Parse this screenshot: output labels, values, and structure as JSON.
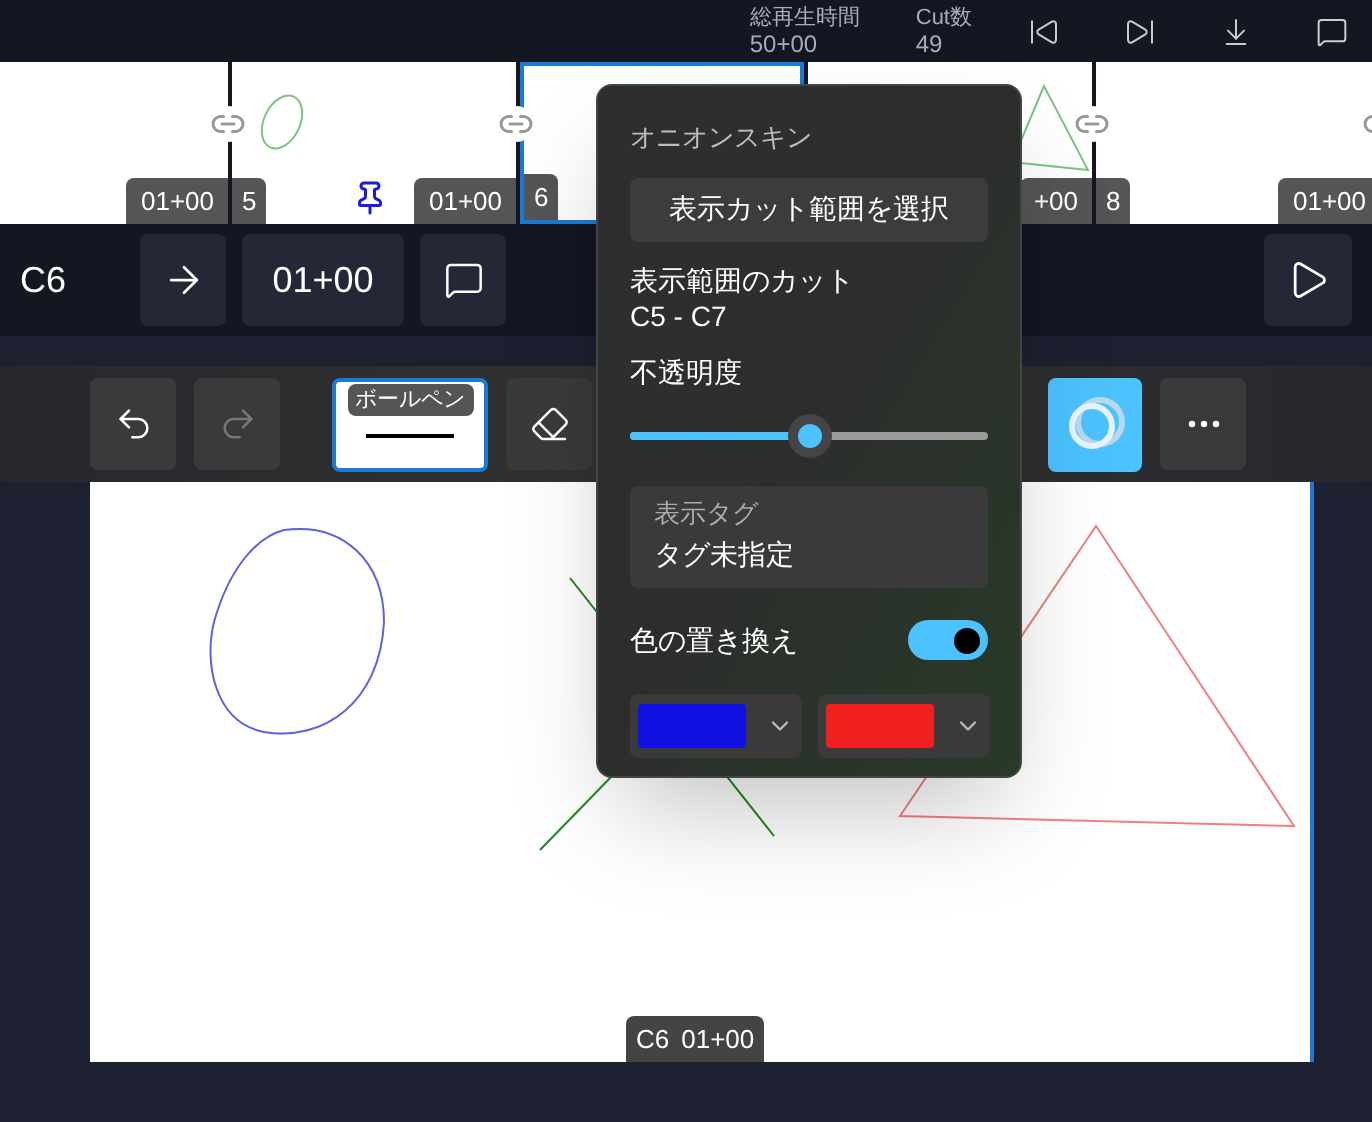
{
  "header": {
    "stats": [
      {
        "label": "総再生時間",
        "value": "50+00"
      },
      {
        "label": "Cut数",
        "value": "49"
      }
    ]
  },
  "filmstrip": [
    {
      "kind": "blank",
      "duration": "01+00",
      "selected": false,
      "pinned": false,
      "linked": true
    },
    {
      "kind": "ellipse",
      "number": "5",
      "duration": "01+00",
      "selected": false,
      "pinned": true,
      "linked": true
    },
    {
      "kind": "blank",
      "number": "6",
      "selected": true,
      "pinned": false,
      "linked": false
    },
    {
      "kind": "triangle",
      "duration": "+00",
      "selected": false,
      "pinned": false,
      "linked": true
    },
    {
      "kind": "blank",
      "number": "8",
      "duration": "01+00",
      "selected": false,
      "pinned": false,
      "linked": true
    }
  ],
  "cut_bar": {
    "cut": "C6",
    "duration": "01+00"
  },
  "toolbar": {
    "pen_label": "ボールペン",
    "pen_selected": true,
    "onion_on": true
  },
  "canvas": {
    "label_cut": "C6",
    "label_duration": "01+00"
  },
  "onion_popup": {
    "title": "オニオンスキン",
    "range_button": "表示カット範囲を選択",
    "range_label": "表示範囲のカット",
    "range_value": "C5 - C7",
    "opacity_label": "不透明度",
    "opacity": {
      "level": 0.5
    },
    "tag_label": "表示タグ",
    "tag_value": "タグ未指定",
    "replace_label": "色の置き換え",
    "replace_on": true,
    "colors": [
      {
        "color": "#1010e0"
      },
      {
        "color": "#f02020"
      }
    ]
  }
}
